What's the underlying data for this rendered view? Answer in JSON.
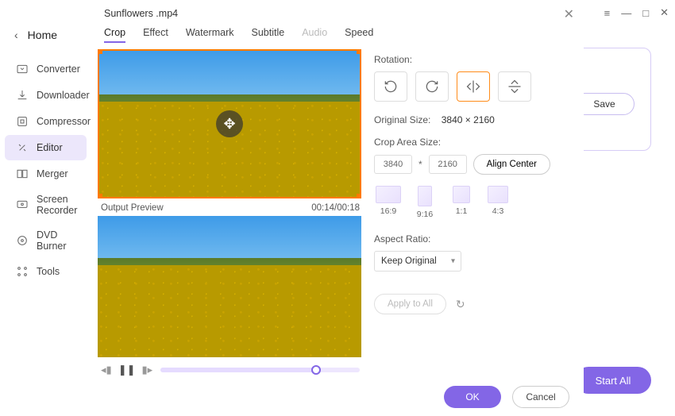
{
  "window": {
    "menu_icon": "≡",
    "minimize_icon": "—",
    "maximize_icon": "□",
    "close_icon": "✕"
  },
  "sidebar": {
    "home": "Home",
    "items": [
      {
        "label": "Converter",
        "icon": "converter-icon"
      },
      {
        "label": "Downloader",
        "icon": "downloader-icon"
      },
      {
        "label": "Compressor",
        "icon": "compressor-icon"
      },
      {
        "label": "Editor",
        "icon": "editor-icon"
      },
      {
        "label": "Merger",
        "icon": "merger-icon"
      },
      {
        "label": "Screen Recorder",
        "icon": "screen-recorder-icon"
      },
      {
        "label": "DVD Burner",
        "icon": "dvd-burner-icon"
      },
      {
        "label": "Tools",
        "icon": "tools-icon"
      }
    ]
  },
  "main": {
    "save_label": "Save",
    "start_all_label": "Start All"
  },
  "modal": {
    "title": "Sunflowers .mp4",
    "tabs": [
      {
        "label": "Crop",
        "active": true,
        "disabled": false
      },
      {
        "label": "Effect",
        "active": false,
        "disabled": false
      },
      {
        "label": "Watermark",
        "active": false,
        "disabled": false
      },
      {
        "label": "Subtitle",
        "active": false,
        "disabled": false
      },
      {
        "label": "Audio",
        "active": false,
        "disabled": true
      },
      {
        "label": "Speed",
        "active": false,
        "disabled": false
      }
    ],
    "preview": {
      "label": "Output Preview",
      "time": "00:14/00:18"
    },
    "rotation": {
      "label": "Rotation:",
      "buttons": [
        "90°",
        "90°",
        "flip-h",
        "flip-v"
      ],
      "active_index": 2
    },
    "original_size": {
      "label": "Original Size:",
      "value": "3840 × 2160"
    },
    "crop_area": {
      "label": "Crop Area Size:",
      "width": "3840",
      "height": "2160",
      "align_label": "Align Center"
    },
    "ratios": [
      {
        "label": "16:9",
        "cls": "r169"
      },
      {
        "label": "9:16",
        "cls": "r916"
      },
      {
        "label": "1:1",
        "cls": "r11"
      },
      {
        "label": "4:3",
        "cls": "r43"
      }
    ],
    "aspect_ratio": {
      "label": "Aspect Ratio:",
      "value": "Keep Original"
    },
    "apply_all_label": "Apply to All",
    "ok_label": "OK",
    "cancel_label": "Cancel"
  }
}
